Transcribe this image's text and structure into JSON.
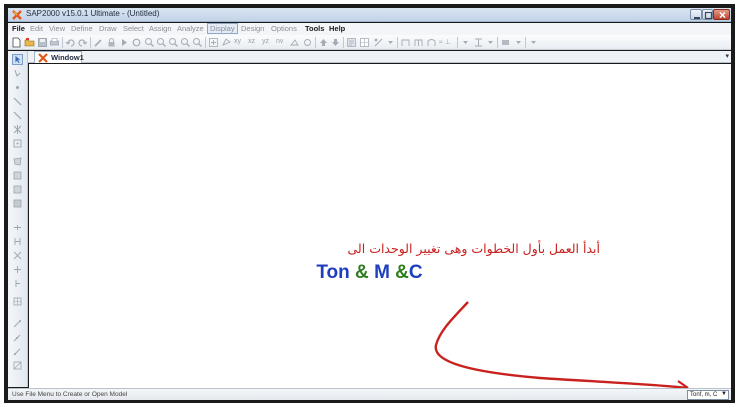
{
  "window": {
    "title": "SAP2000 v15.0.1 Ultimate - (Untitled)"
  },
  "menu": {
    "items": [
      {
        "label": "File",
        "enabled": true
      },
      {
        "label": "Edit",
        "enabled": false
      },
      {
        "label": "View",
        "enabled": false
      },
      {
        "label": "Define",
        "enabled": false
      },
      {
        "label": "Draw",
        "enabled": false
      },
      {
        "label": "Select",
        "enabled": false
      },
      {
        "label": "Assign",
        "enabled": false
      },
      {
        "label": "Analyze",
        "enabled": false
      },
      {
        "label": "Display",
        "enabled": false
      },
      {
        "label": "Design",
        "enabled": false
      },
      {
        "label": "Options",
        "enabled": false
      },
      {
        "label": "Tools",
        "enabled": true
      },
      {
        "label": "Help",
        "enabled": true
      }
    ]
  },
  "toolbar": {
    "view_labels": [
      "xy",
      "xz",
      "yz",
      "nv"
    ]
  },
  "tabs": {
    "active": {
      "label": "Window1"
    },
    "dropdown_glyph": "▾"
  },
  "canvas": {
    "arabic_note": "أبدأ العمل بأول الخطوات  وهى تغيير الوحدات الى",
    "units_parts": [
      {
        "text": "Ton",
        "color": "#1f3fbf"
      },
      {
        "text": " & ",
        "color": "#2e7d1e"
      },
      {
        "text": "M",
        "color": "#1f3fbf"
      },
      {
        "text": " &",
        "color": "#2e7d1e"
      },
      {
        "text": "C",
        "color": "#1f3fbf"
      }
    ],
    "arrow_color": "#c8211e"
  },
  "statusbar": {
    "message": "Use File Menu to Create or Open Model",
    "units_value": "Tonf, m, C"
  },
  "colors": {
    "accent": "#c8211e",
    "units_blue": "#1f3fbf",
    "units_green": "#2e7d1e"
  }
}
